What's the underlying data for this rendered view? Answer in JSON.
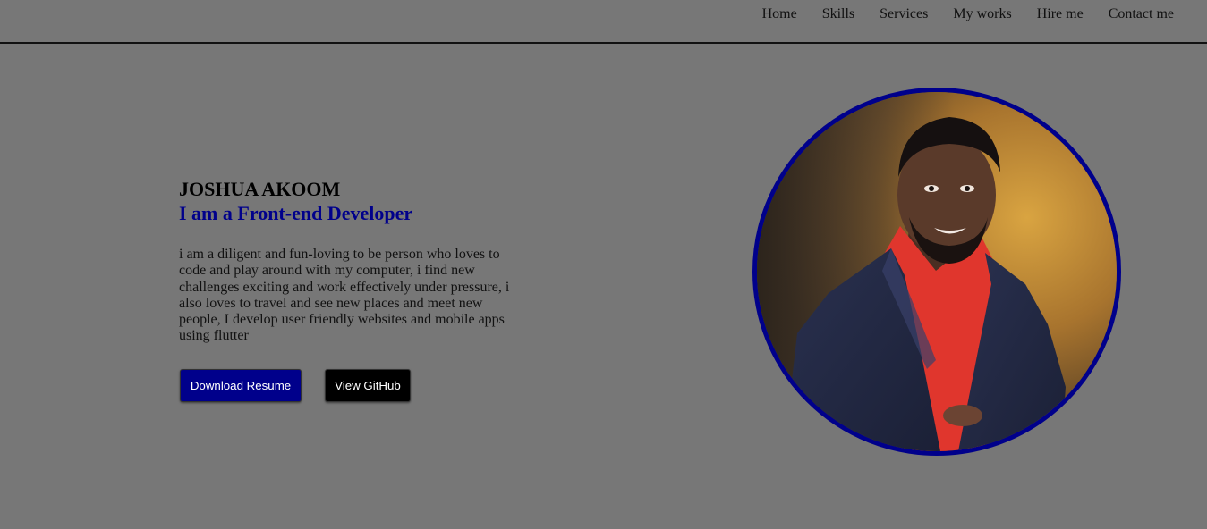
{
  "nav": {
    "items": [
      {
        "label": "Home"
      },
      {
        "label": "Skills"
      },
      {
        "label": "Services"
      },
      {
        "label": "My works"
      },
      {
        "label": "Hire me"
      },
      {
        "label": "Contact me"
      }
    ]
  },
  "hero": {
    "name": "JOSHUA AKOOM",
    "role": "I am a Front-end Developer",
    "bio": "i am a diligent and fun-loving to be person who loves to code and play around with my computer, i find new challenges exciting and work effectively under pressure, i also loves to travel and see new places and meet new people, I develop user friendly websites and mobile apps using flutter",
    "download_label": "Download Resume",
    "github_label": "View GitHub"
  },
  "colors": {
    "background": "#777777",
    "accent": "#00008b",
    "github_button": "#000000"
  }
}
